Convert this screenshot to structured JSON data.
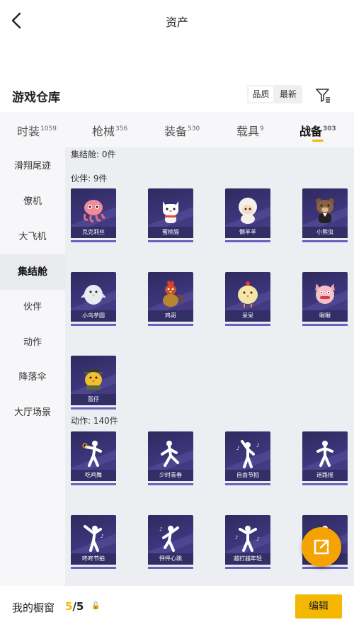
{
  "header": {
    "title": "资产"
  },
  "section": {
    "title": "游戏仓库"
  },
  "sort": {
    "options": [
      "品质",
      "最新"
    ]
  },
  "tabs": [
    {
      "label": "时装",
      "count": "1059"
    },
    {
      "label": "枪械",
      "count": "356"
    },
    {
      "label": "装备",
      "count": "530"
    },
    {
      "label": "载具",
      "count": "9"
    },
    {
      "label": "战备",
      "count": "303"
    }
  ],
  "sidebar": {
    "items": [
      "滑翔尾迹",
      "僚机",
      "大飞机",
      "集结舱",
      "伙伴",
      "动作",
      "降落伞",
      "大厅场景"
    ]
  },
  "groups": {
    "assembly": "集结舱: 0件",
    "partners": "伙伴: 9件",
    "actions": "动作: 140件"
  },
  "partner_cards": [
    "克克莉丝",
    "蜜桃猫",
    "懒羊羊",
    "小熊虫",
    "小鸟芋圆",
    "鸡哥",
    "呆呆",
    "啾啾",
    "盔仔"
  ],
  "action_cards": [
    "吃鸡舞",
    "少时青春",
    "自由节拍",
    "迷路摇",
    "咚咚节拍",
    "怦怦心跳",
    "越打越年轻",
    ""
  ],
  "bottom": {
    "label": "我的橱窗",
    "current": "5",
    "total": "/5",
    "icon_glyph": "🔓",
    "edit": "编辑"
  },
  "colors": {
    "accent": "#f5b800",
    "card_bg": "#3c3478"
  }
}
